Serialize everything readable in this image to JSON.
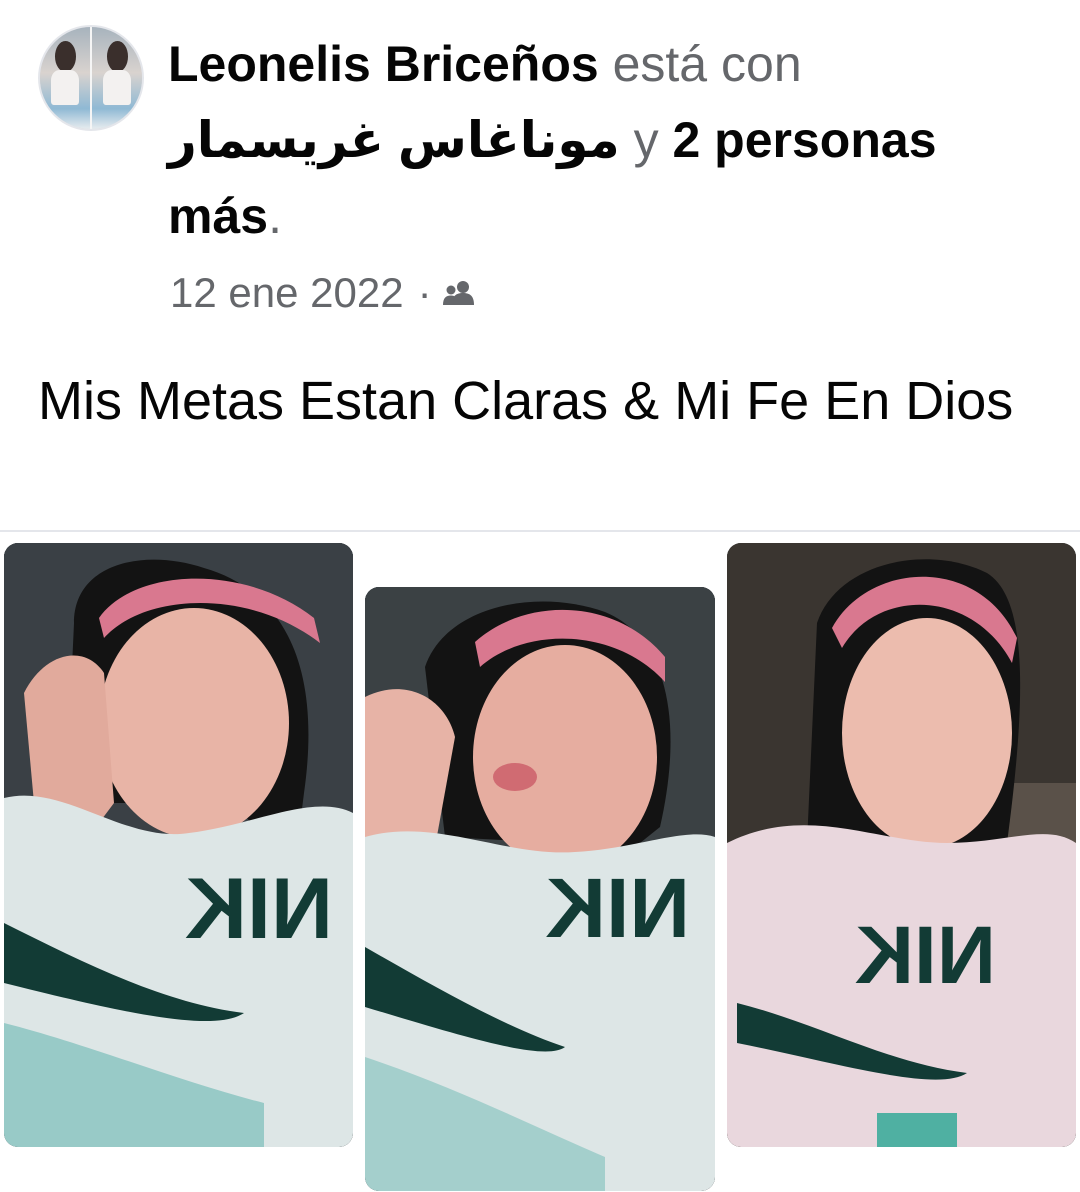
{
  "post": {
    "author": "Leonelis Briceños",
    "with_text": "está con",
    "tagged_person": "موناغاس غريسمار",
    "and_text": "y",
    "others_text": "2 personas más",
    "period": ".",
    "date": "12 ene 2022",
    "separator": "·",
    "audience_icon": "friends-icon",
    "caption": "Mis Metas Estan Claras & Mi Fe En Dios",
    "shirt_text": "NIK"
  },
  "colors": {
    "text_primary": "#050505",
    "text_secondary": "#65676b",
    "divider": "#e4e6eb",
    "headband": "#d9788f",
    "shirt": "#dde6e6",
    "hair": "#141414",
    "skin": "#e8b4a6",
    "logo": "#123b35"
  }
}
